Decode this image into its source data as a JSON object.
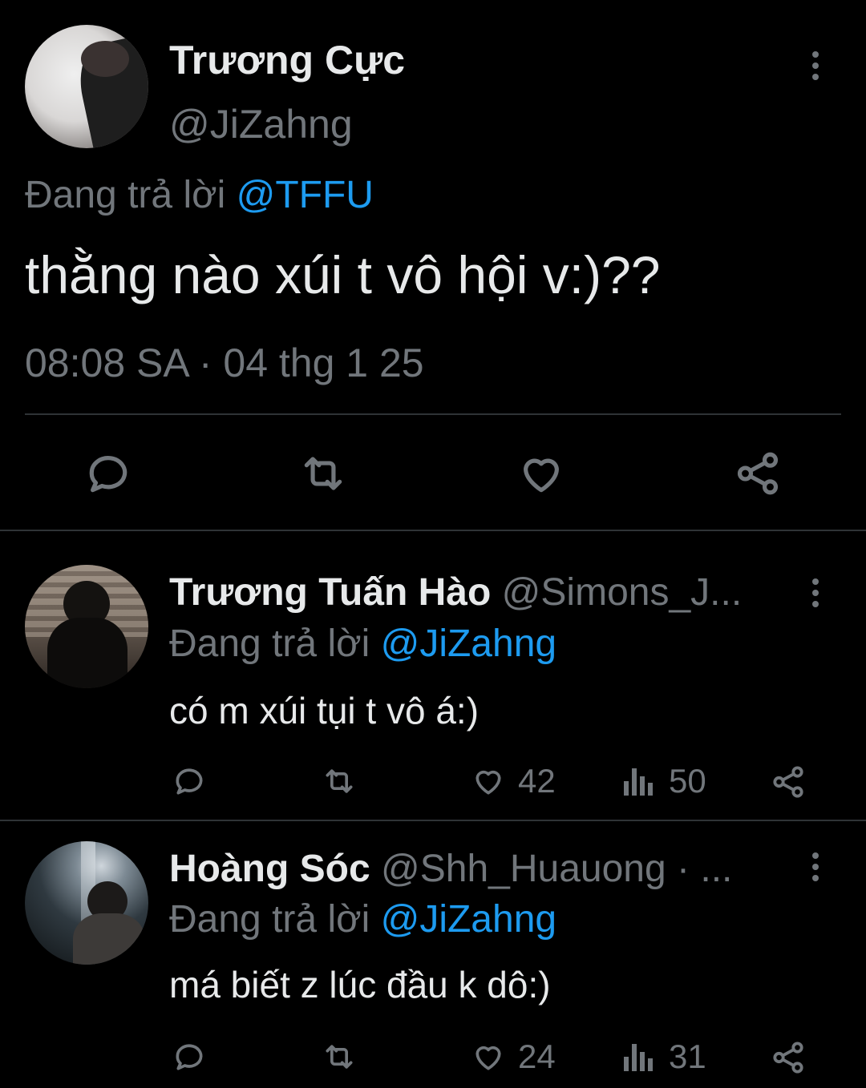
{
  "main_tweet": {
    "display_name": "Trương Cực",
    "handle": "@JiZahng",
    "reply_prefix": "Đang trả lời",
    "reply_to": "@TFFU",
    "text": "thằng nào xúi t vô hội v:)??",
    "timestamp": "08:08 SA · 04 thg 1 25"
  },
  "replies": [
    {
      "display_name": "Trương Tuấn Hào",
      "handle": "@Simons_J...",
      "reply_prefix": "Đang trả lời",
      "reply_to": "@JiZahng",
      "text": "có m xúi tụi t vô á:)",
      "likes": "42",
      "views": "50"
    },
    {
      "display_name": "Hoàng Sóc",
      "handle": "@Shh_Huauong · ...",
      "reply_prefix": "Đang trả lời",
      "reply_to": "@JiZahng",
      "text": "má biết z lúc đầu k dô:)",
      "likes": "24",
      "views": "31"
    }
  ],
  "icons": {
    "reply": "reply-icon",
    "retweet": "retweet-icon",
    "like": "heart-icon",
    "share": "share-icon",
    "views": "views-icon",
    "more": "more-icon"
  },
  "colors": {
    "background": "#000000",
    "text": "#e7e9ea",
    "muted": "#71767b",
    "link": "#1d9bf0"
  }
}
